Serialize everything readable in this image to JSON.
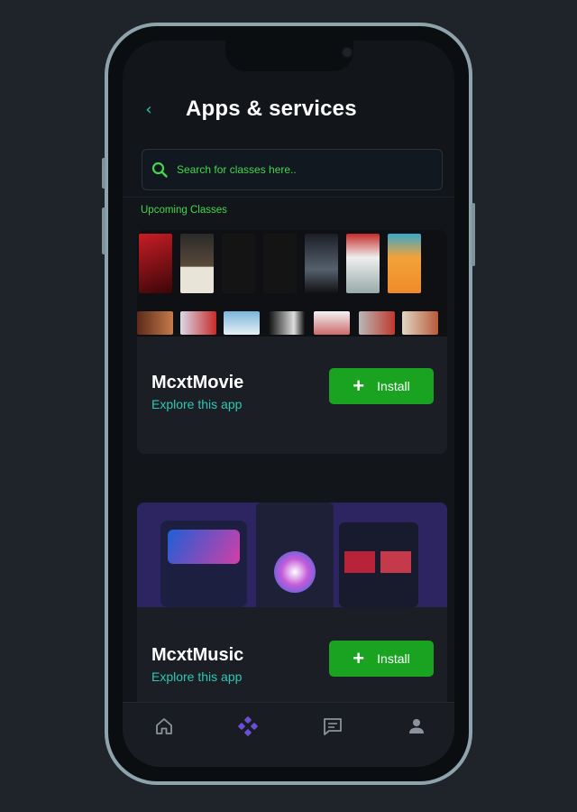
{
  "header": {
    "title": "Apps & services",
    "back_icon": "chevron-left-icon"
  },
  "search": {
    "placeholder": "Search for classes here..",
    "icon": "search-icon"
  },
  "section": {
    "label": "Upcoming Classes"
  },
  "apps": [
    {
      "name": "McxtMovie",
      "subtitle": "Explore this app",
      "install_label": "Install"
    },
    {
      "name": "McxtMusic",
      "subtitle": "Explore this app",
      "install_label": "Install"
    }
  ],
  "bottom_nav": [
    {
      "icon": "home-icon"
    },
    {
      "icon": "apps-icon",
      "active": true
    },
    {
      "icon": "chat-icon"
    },
    {
      "icon": "profile-icon"
    }
  ],
  "colors": {
    "background": "#1f232a",
    "screen": "#12161b",
    "accent_green": "#43d64e",
    "teal": "#2fc7b3",
    "install_button": "#1aa321",
    "active_nav": "#6c4fd8"
  }
}
